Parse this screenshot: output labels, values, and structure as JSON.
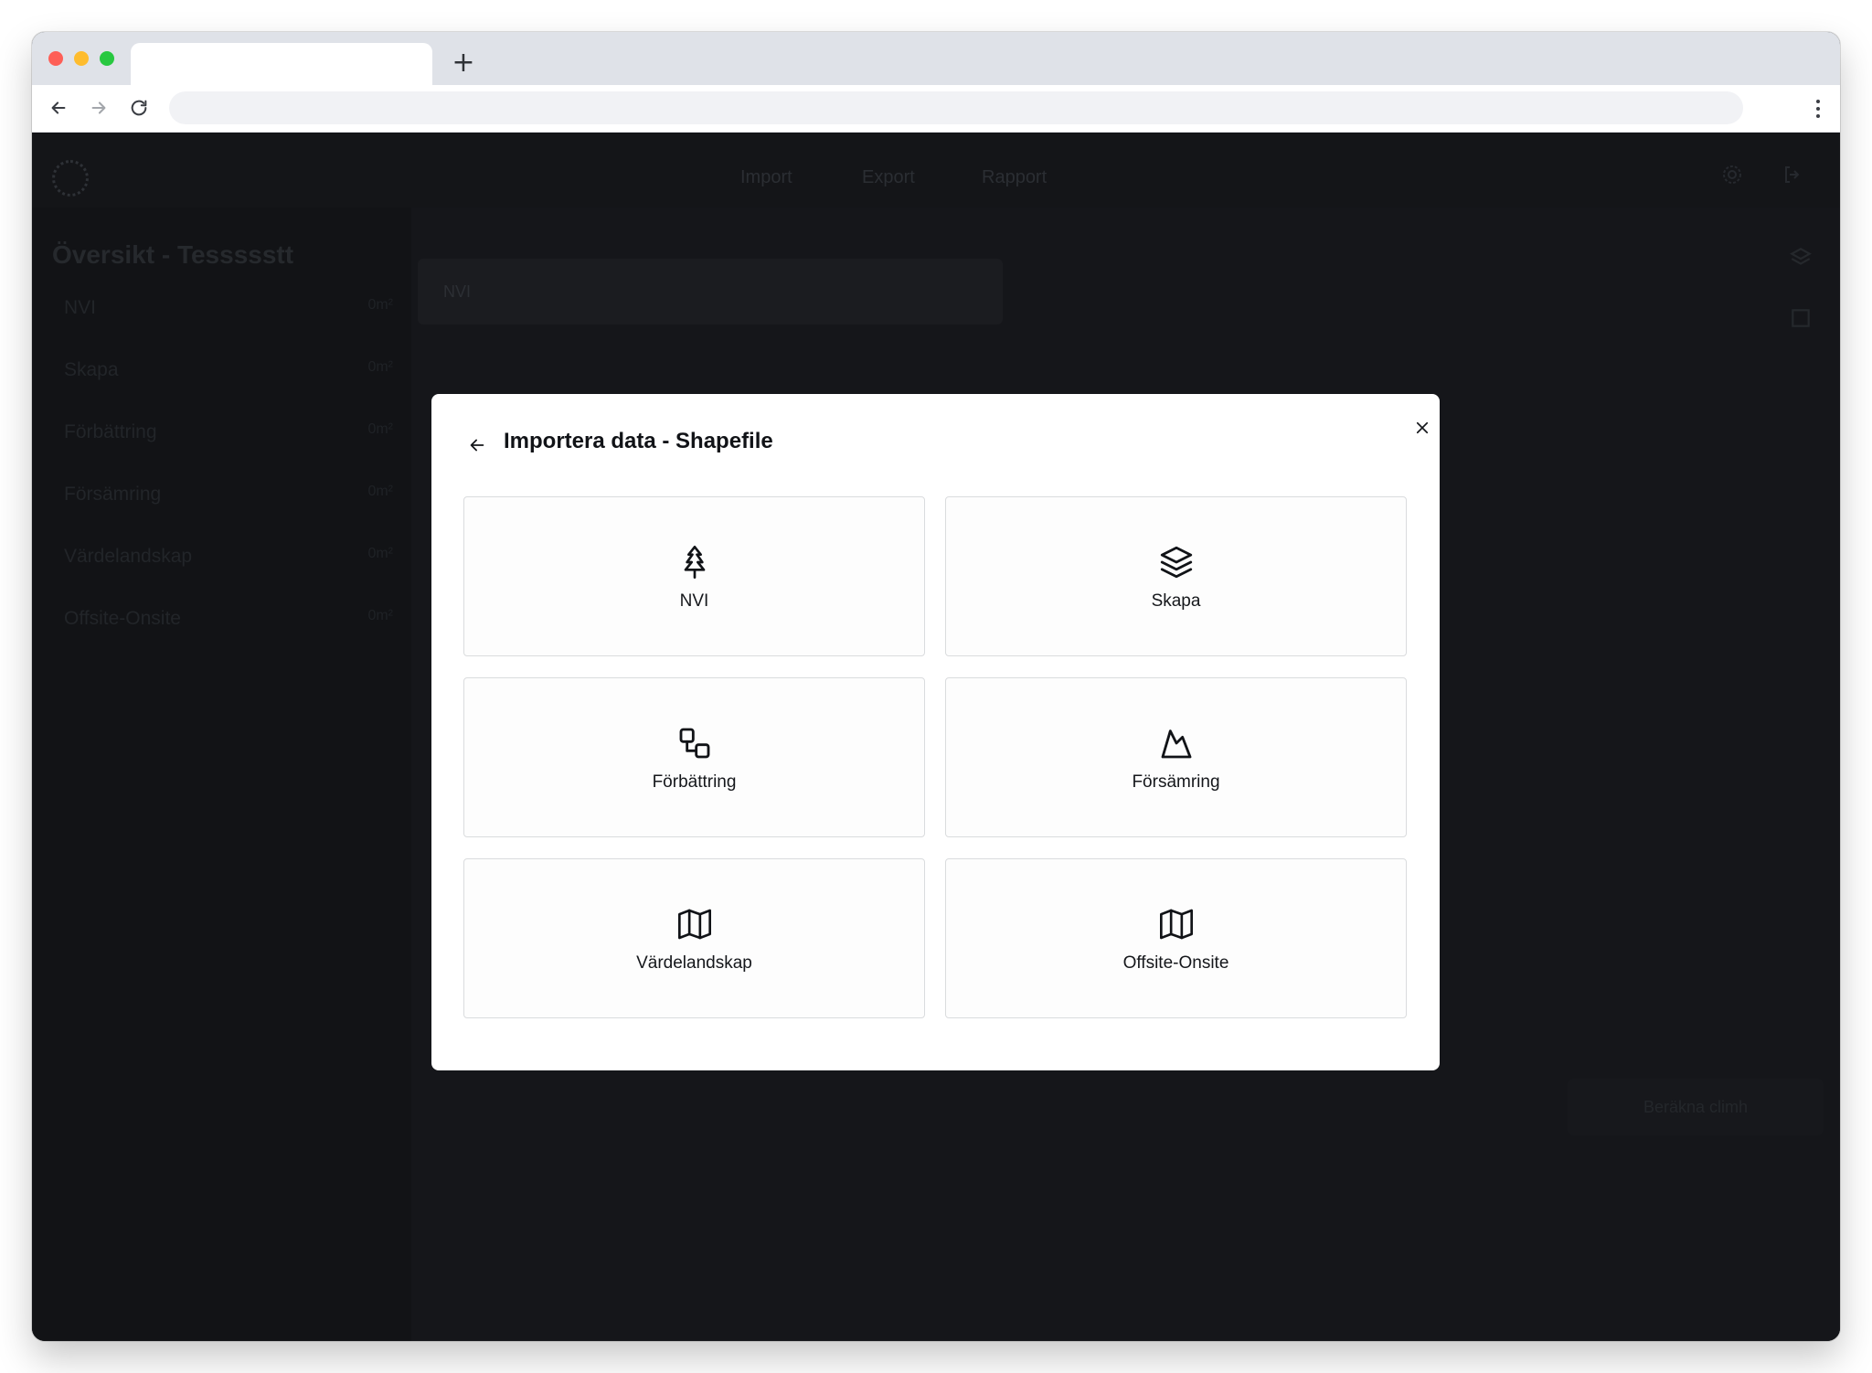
{
  "browser": {
    "tab_title": "",
    "new_tab_label": "+",
    "address": ""
  },
  "app": {
    "menu": [
      {
        "label": "Import"
      },
      {
        "label": "Export"
      },
      {
        "label": "Rapport"
      }
    ],
    "sidebar": {
      "title": "Översikt - Tessssstt",
      "items": [
        {
          "label": "NVI",
          "value": "0m²"
        },
        {
          "label": "Skapa",
          "value": "0m²"
        },
        {
          "label": "Förbättring",
          "value": "0m²"
        },
        {
          "label": "Försämring",
          "value": "0m²"
        },
        {
          "label": "Värdelandskap",
          "value": "0m²"
        },
        {
          "label": "Offsite-Onsite",
          "value": "0m²"
        }
      ]
    },
    "map": {
      "layer_select": "NVI",
      "action_button": "Beräkna climh"
    }
  },
  "modal": {
    "title": "Importera data - Shapefile",
    "options": [
      {
        "label": "NVI",
        "icon": "tree-icon"
      },
      {
        "label": "Skapa",
        "icon": "layers-icon"
      },
      {
        "label": "Förbättring",
        "icon": "workflow-icon"
      },
      {
        "label": "Försämring",
        "icon": "mountain-icon"
      },
      {
        "label": "Värdelandskap",
        "icon": "map-icon"
      },
      {
        "label": "Offsite-Onsite",
        "icon": "map-icon"
      }
    ]
  }
}
